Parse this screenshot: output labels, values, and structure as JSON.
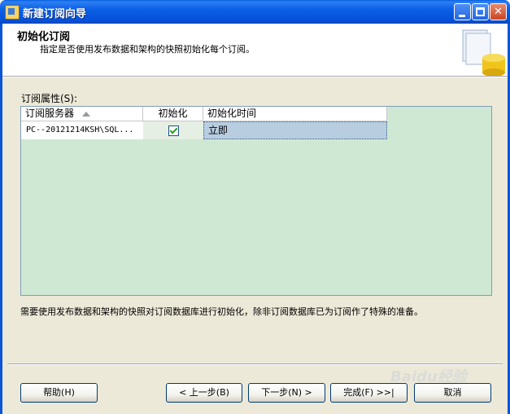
{
  "window": {
    "title": "新建订阅向导",
    "controls": [
      "minimize",
      "maximize",
      "close"
    ]
  },
  "header": {
    "title": "初始化订阅",
    "description": "指定是否使用发布数据和架构的快照初始化每个订阅。"
  },
  "grid": {
    "label": "订阅属性(S):",
    "columns": [
      "订阅服务器",
      "初始化",
      "初始化时间"
    ],
    "sorted_column": "订阅服务器",
    "rows": [
      {
        "subscriber": "PC--20121214KSH\\SQL...",
        "initialize": true,
        "init_time": "立即"
      }
    ]
  },
  "hint": "需要使用发布数据和架构的快照对订阅数据库进行初始化，除非订阅数据库已为订阅作了特殊的准备。",
  "buttons": {
    "help": "帮助(H)",
    "back": "< 上一步(B)",
    "next": "下一步(N) >",
    "finish": "完成(F) >>|",
    "cancel": "取消"
  },
  "watermark": "Baidu经验",
  "colors": {
    "titlebar": "#0550d9",
    "grid_background": "#cfe8d4",
    "selected_cell": "#b8cde0",
    "dialog_background": "#ece9d8"
  }
}
